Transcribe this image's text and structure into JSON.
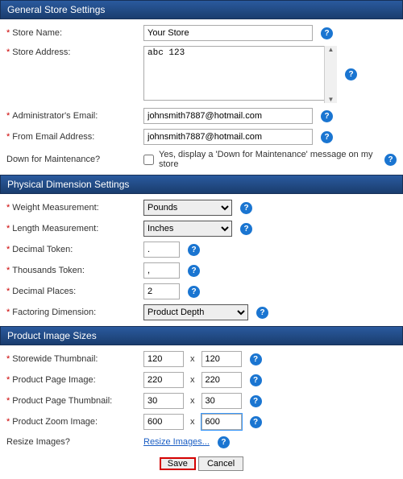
{
  "sections": {
    "general": {
      "title": "General Store Settings"
    },
    "physical": {
      "title": "Physical Dimension Settings"
    },
    "images": {
      "title": "Product Image Sizes"
    }
  },
  "general": {
    "store_name_label": "Store Name:",
    "store_name_value": "Your Store",
    "store_address_label": "Store Address:",
    "store_address_value": "abc 123",
    "admin_email_label": "Administrator's Email:",
    "admin_email_value": "johnsmith7887@hotmail.com",
    "from_email_label": "From Email Address:",
    "from_email_value": "johnsmith7887@hotmail.com",
    "down_label": "Down for Maintenance?",
    "down_text": "Yes, display a 'Down for Maintenance' message on my store"
  },
  "physical": {
    "weight_label": "Weight Measurement:",
    "weight_value": "Pounds",
    "length_label": "Length Measurement:",
    "length_value": "Inches",
    "decimal_token_label": "Decimal Token:",
    "decimal_token_value": ".",
    "thousands_token_label": "Thousands Token:",
    "thousands_token_value": ",",
    "decimal_places_label": "Decimal Places:",
    "decimal_places_value": "2",
    "factoring_label": "Factoring Dimension:",
    "factoring_value": "Product Depth"
  },
  "images": {
    "storewide_label": "Storewide Thumbnail:",
    "storewide_w": "120",
    "storewide_h": "120",
    "ppi_label": "Product Page Image:",
    "ppi_w": "220",
    "ppi_h": "220",
    "ppt_label": "Product Page Thumbnail:",
    "ppt_w": "30",
    "ppt_h": "30",
    "pzi_label": "Product Zoom Image:",
    "pzi_w": "600",
    "pzi_h": "600",
    "resize_label": "Resize Images?",
    "resize_link": "Resize Images...",
    "x": "x"
  },
  "required_mark": "*",
  "help_mark": "?",
  "buttons": {
    "save": "Save",
    "cancel": "Cancel"
  }
}
